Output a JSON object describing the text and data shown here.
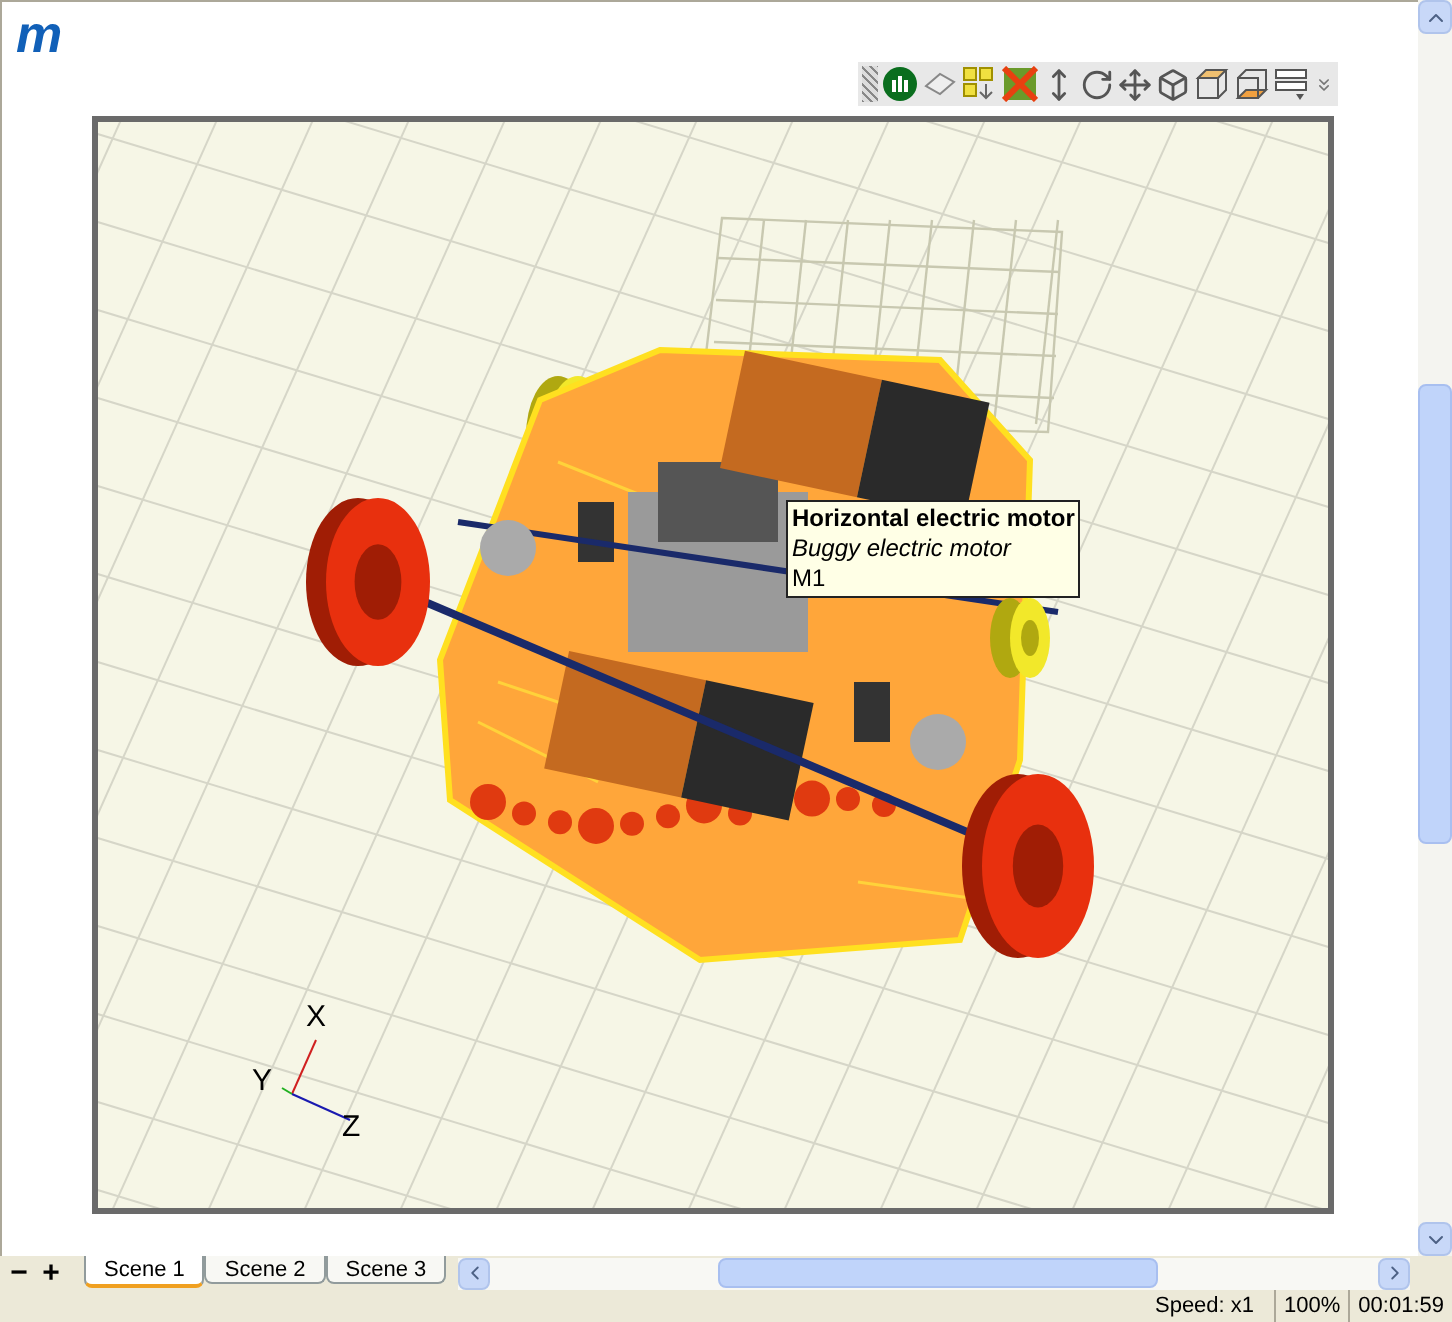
{
  "logo": {
    "text": "m"
  },
  "tooltip": {
    "title": "Horizontal electric motor",
    "subtitle": "Buggy electric motor",
    "reference": "M1"
  },
  "axes": {
    "x": "X",
    "y": "Y",
    "z": "Z"
  },
  "zoom_buttons": [
    "−",
    "+"
  ],
  "scene_tabs": [
    {
      "label": "Scene 1",
      "selected": true
    },
    {
      "label": "Scene 2",
      "selected": false
    },
    {
      "label": "Scene 3",
      "selected": false
    }
  ],
  "status_bar": {
    "speed": "Speed: x1",
    "zoom": "100%",
    "time": "00:01:59"
  }
}
